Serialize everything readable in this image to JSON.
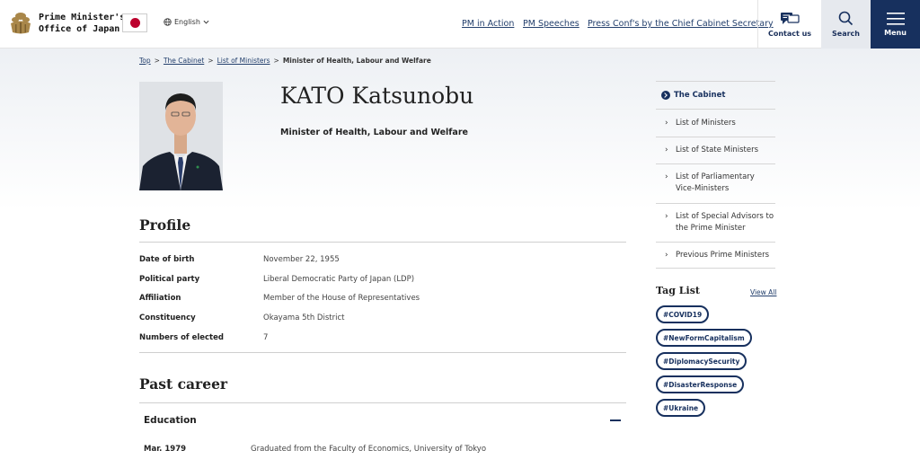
{
  "header": {
    "site_name": "Prime Minister's\nOffice of Japan",
    "language": "English",
    "nav": [
      "PM in Action",
      "PM Speeches",
      "Press Conf's by the Chief Cabinet Secretary"
    ],
    "contact_label": "Contact us",
    "search_label": "Search",
    "menu_label": "Menu"
  },
  "breadcrumb": {
    "items": [
      "Top",
      "The Cabinet",
      "List of Ministers"
    ],
    "separator": ">",
    "current": "Minister of Health, Labour and Welfare"
  },
  "profile_header": {
    "name": "KATO Katsunobu",
    "title": "Minister of Health, Labour and Welfare"
  },
  "profile": {
    "heading": "Profile",
    "rows": [
      {
        "label": "Date of birth",
        "value": "November 22, 1955"
      },
      {
        "label": "Political party",
        "value": "Liberal Democratic Party of Japan (LDP)"
      },
      {
        "label": "Affiliation",
        "value": "Member of the House of Representatives"
      },
      {
        "label": "Constituency",
        "value": "Okayama 5th District"
      },
      {
        "label": "Numbers of elected",
        "value": "7"
      }
    ]
  },
  "career": {
    "heading": "Past career",
    "education": {
      "heading": "Education",
      "rows": [
        {
          "date": "Mar. 1979",
          "text": "Graduated from the Faculty of Economics, University of Tokyo"
        }
      ]
    }
  },
  "sidebar": {
    "heading": "The Cabinet",
    "items": [
      {
        "label": "List of Ministers"
      },
      {
        "label": "List of State Ministers"
      },
      {
        "label": "List of Parliamentary Vice-Ministers"
      },
      {
        "label": "List of Special Advisors to the Prime Minister"
      },
      {
        "label": "Previous Prime Ministers"
      }
    ]
  },
  "tags": {
    "heading": "Tag List",
    "view_all": "View All",
    "items": [
      "#COVID19",
      "#NewFormCapitalism",
      "#DiplomacySecurity",
      "#DisasterResponse",
      "#Ukraine"
    ]
  },
  "colors": {
    "navy": "#17305e",
    "link": "#24406d",
    "flag_red": "#bc002d"
  },
  "icons": [
    "chrysanthemum-logo-icon",
    "japan-flag-icon",
    "globe-icon",
    "chevron-down-icon",
    "chat-bubble-icon",
    "search-icon",
    "hamburger-menu-icon",
    "chevron-right-icon",
    "circle-arrow-icon",
    "minus-icon"
  ]
}
